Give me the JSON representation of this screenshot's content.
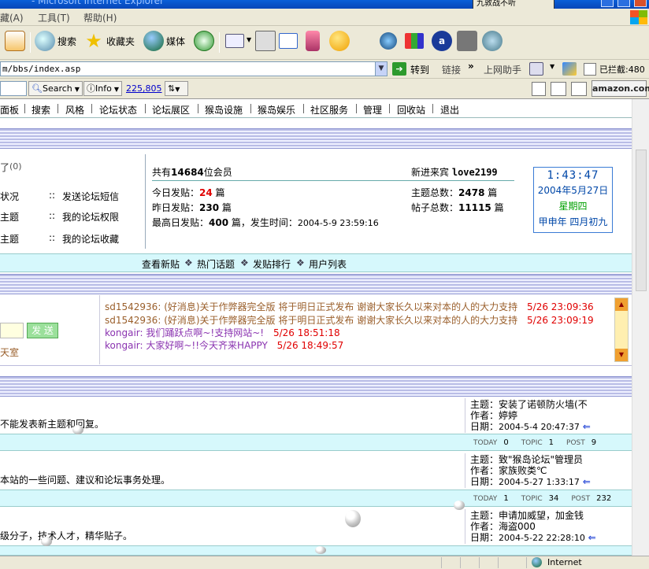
{
  "browser": {
    "title": "- Microsoft Internet Explorer",
    "popup_label": "九敦战不听",
    "menus": [
      "藏(A)",
      "工具(T)",
      "帮助(H)"
    ],
    "toolbar": {
      "search": "搜索",
      "favorites": "收藏夹",
      "media": "媒体"
    },
    "address": {
      "url": "m/bbs/index.asp",
      "go": "转到",
      "links": "链接",
      "chevron": "»",
      "helper": "上网助手",
      "blocked": "已拦截:480"
    },
    "links_bar": {
      "search_btn": "Search",
      "info_btn": "Info",
      "count": "225,805",
      "amazon": "amazon.com"
    },
    "status": {
      "zone": "Internet"
    }
  },
  "forum": {
    "nav": [
      "面板",
      "搜索",
      "风格",
      "论坛状态",
      "论坛展区",
      "猴岛设施",
      "猴岛娱乐",
      "社区服务",
      "管理",
      "回收站",
      "退出"
    ],
    "left_panel": {
      "paren": "(0)",
      "items": [
        {
          "left": "状况",
          "right": "发送论坛短信"
        },
        {
          "left": "主题",
          "right": "我的论坛权限"
        },
        {
          "left": "主题",
          "right": "我的论坛收藏"
        }
      ],
      "sep": "::"
    },
    "stats": {
      "members_prefix": "共有",
      "members": "14684",
      "members_suffix": "位会员",
      "newest_label": "新进来宾",
      "newest": "love2199",
      "today_label": "今日发贴：",
      "today": "24",
      "yesterday_label": "昨日发贴：",
      "yesterday": "230",
      "unit": "篇",
      "topics_label": "主题总数：",
      "topics": "2478",
      "posts_label": "帖子总数：",
      "posts": "11115",
      "max_label": "最高日发贴：",
      "max": "400",
      "max_mid": "篇，发生时间：",
      "max_time": "2004-5-9 23:59:16"
    },
    "clock": {
      "time": "1:43:47",
      "date": "2004年5月27日",
      "weekday": "星期四",
      "lunar": "甲申年  四月初九"
    },
    "quicklinks": [
      "查看新贴",
      "热门话题",
      "发贴排行",
      "用户列表"
    ],
    "quick_sep": "❖",
    "chat": {
      "send": "发 送",
      "room_tail": "天室",
      "lines": [
        {
          "user": "sd1542936:",
          "msg": "(好消息)关于作弊器完全版 将于明日正式发布 谢谢大家长久以来对本的人的大力支持",
          "time": "5/26 23:09:36"
        },
        {
          "user": "sd1542936:",
          "msg": "(好消息)关于作弊器完全版 将于明日正式发布 谢谢大家长久以来对本的人的大力支持",
          "time": "5/26 23:09:19"
        },
        {
          "user": "kongair:",
          "msg": "我们踊跃点啊~!支持网站~!",
          "time": "5/26 18:51:18"
        },
        {
          "user": "kongair:",
          "msg": "大家好啊~!!今天齐来HAPPY",
          "time": "5/26 18:49:57"
        }
      ]
    },
    "boards": [
      {
        "desc": "不能发表新主题和回复。",
        "topic_label": "主题：",
        "topic": "安装了诺顿防火墙(不",
        "author_label": "作者：",
        "author": "婷婷",
        "date_label": "日期：",
        "date": "2004-5-4 20:47:37",
        "today": "0",
        "topic_count": "1",
        "post_count": "9"
      },
      {
        "desc": "本站的一些问题、建议和论坛事务处理。",
        "topic_label": "主题：",
        "topic": "致\"猴岛论坛\"管理员",
        "author_label": "作者：",
        "author": "家族败类℃",
        "date_label": "日期：",
        "date": "2004-5-27 1:33:17",
        "today": "1",
        "topic_count": "34",
        "post_count": "232"
      },
      {
        "desc": "级分子，技术人才，精华贴子。",
        "topic_label": "主题：",
        "topic": "申请加威望，加金钱",
        "author_label": "作者：",
        "author": "海盗000",
        "date_label": "日期：",
        "date": "2004-5-22 22:28:10"
      }
    ],
    "stat_labels": {
      "today": "TODAY",
      "topic": "TOPIC",
      "post": "POST"
    }
  }
}
